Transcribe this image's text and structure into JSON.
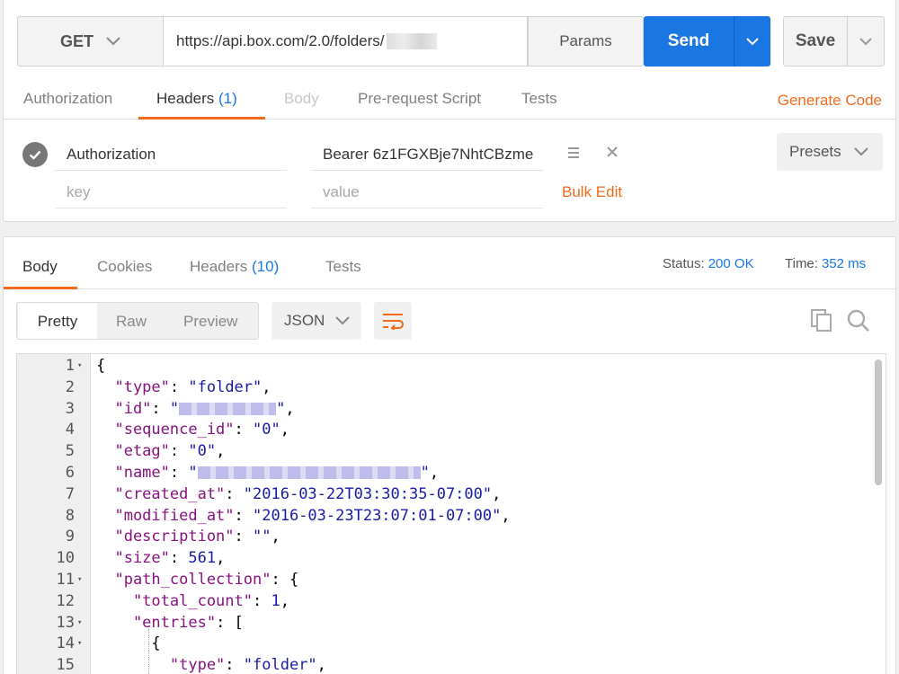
{
  "request": {
    "method": "GET",
    "url": "https://api.box.com/2.0/folders/",
    "params_label": "Params",
    "send_label": "Send",
    "save_label": "Save",
    "tabs": [
      {
        "label": "Authorization",
        "count": ""
      },
      {
        "label": "Headers",
        "count": "(1)"
      },
      {
        "label": "Body",
        "count": ""
      },
      {
        "label": "Pre-request Script",
        "count": ""
      },
      {
        "label": "Tests",
        "count": ""
      }
    ],
    "generate_code_label": "Generate Code",
    "headers": [
      {
        "key": "Authorization",
        "value": "Bearer 6z1FGXBje7NhtCBzme"
      }
    ],
    "key_placeholder": "key",
    "value_placeholder": "value",
    "bulk_edit_label": "Bulk Edit",
    "presets_label": "Presets"
  },
  "response": {
    "tabs": [
      {
        "label": "Body",
        "count": ""
      },
      {
        "label": "Cookies",
        "count": ""
      },
      {
        "label": "Headers",
        "count": "(10)"
      },
      {
        "label": "Tests",
        "count": ""
      }
    ],
    "status_label": "Status:",
    "status_value": "200 OK",
    "time_label": "Time:",
    "time_value": "352 ms",
    "view_modes": [
      "Pretty",
      "Raw",
      "Preview"
    ],
    "format": "JSON",
    "lines": [
      {
        "n": "1",
        "fold": true,
        "text": "{"
      },
      {
        "n": "2",
        "fold": false,
        "key": "type",
        "val": "\"folder\""
      },
      {
        "n": "3",
        "fold": false,
        "key": "id",
        "val": "\"",
        "blur": 108
      },
      {
        "n": "4",
        "fold": false,
        "key": "sequence_id",
        "val": "\"0\""
      },
      {
        "n": "5",
        "fold": false,
        "key": "etag",
        "val": "\"0\""
      },
      {
        "n": "6",
        "fold": false,
        "key": "name",
        "val": "\"",
        "blur": 248
      },
      {
        "n": "7",
        "fold": false,
        "key": "created_at",
        "val": "\"2016-03-22T03:30:35-07:00\""
      },
      {
        "n": "8",
        "fold": false,
        "key": "modified_at",
        "val": "\"2016-03-23T23:07:01-07:00\""
      },
      {
        "n": "9",
        "fold": false,
        "key": "description",
        "val": "\"\""
      },
      {
        "n": "10",
        "fold": false,
        "key": "size",
        "val": "561",
        "num": true
      },
      {
        "n": "11",
        "fold": true,
        "key": "path_collection",
        "val": "{",
        "open": true
      },
      {
        "n": "12",
        "fold": false,
        "key": "total_count",
        "val": "1",
        "num": true,
        "indent": 2
      },
      {
        "n": "13",
        "fold": true,
        "key": "entries",
        "val": "[",
        "open": true,
        "indent": 2
      },
      {
        "n": "14",
        "fold": true,
        "text": "{",
        "indent": 3
      },
      {
        "n": "15",
        "fold": false,
        "key": "type",
        "val": "\"folder\"",
        "indent": 4
      }
    ]
  },
  "colors": {
    "accent": "#f26b1d",
    "send": "#1a76e3",
    "json_key": "#881280",
    "json_value": "#1a1aa6"
  }
}
